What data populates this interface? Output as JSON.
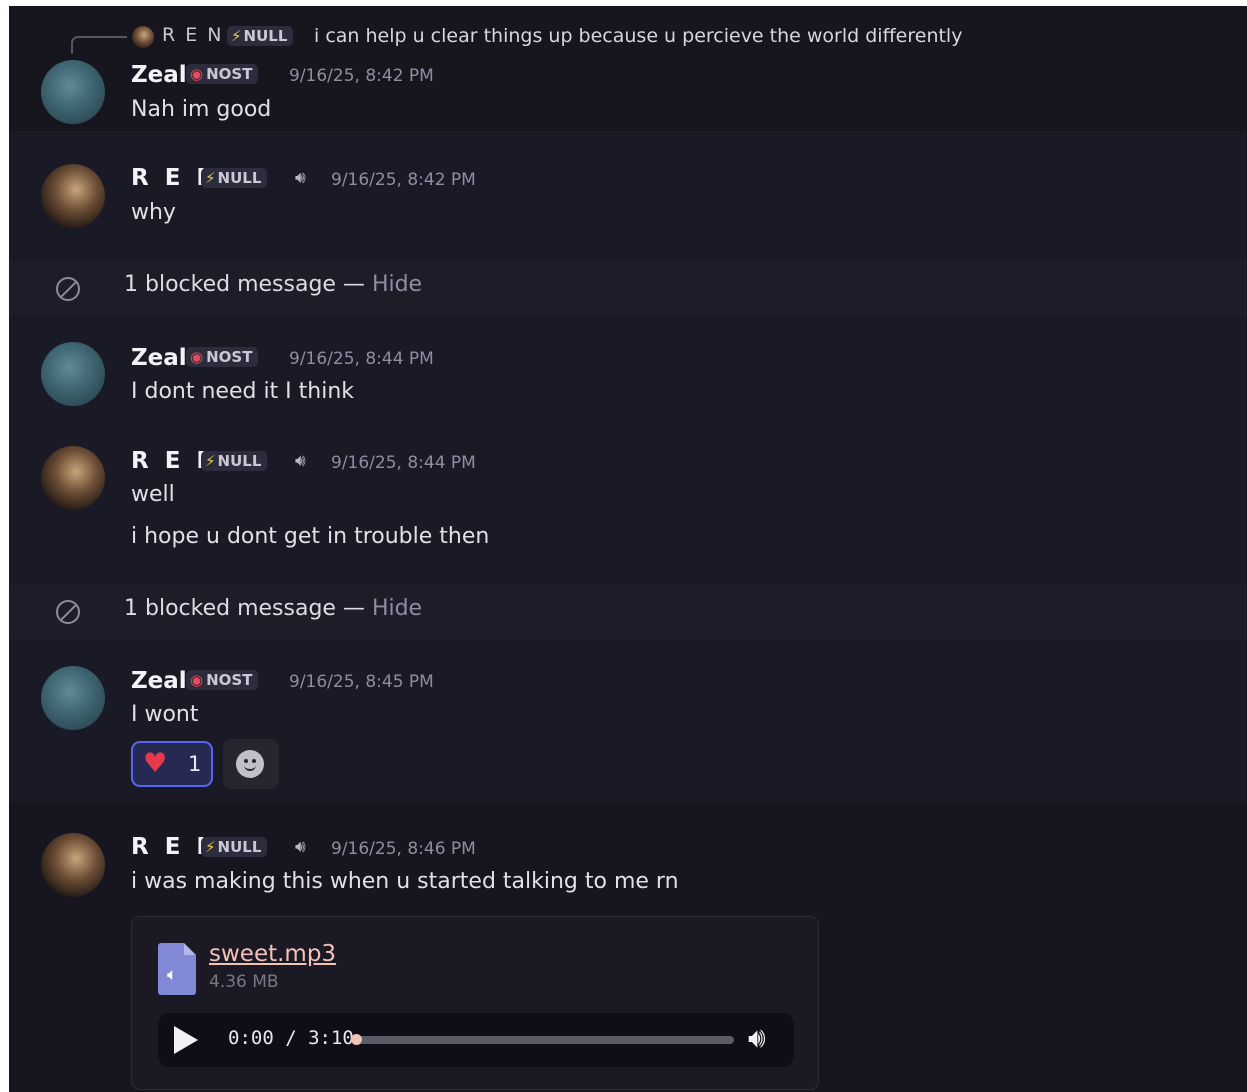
{
  "reply": {
    "author": "R E N",
    "tag": "NULL",
    "text": "i can help u clear things up because u percieve the world differently"
  },
  "messages": [
    {
      "author": "Zeal",
      "tag": "NOST",
      "timestamp": "9/16/25, 8:42 PM",
      "lines": [
        "Nah im good"
      ]
    },
    {
      "author": "R E N",
      "tag": "NULL",
      "timestamp": "9/16/25, 8:42 PM",
      "lines": [
        "why"
      ]
    },
    {
      "author": "Zeal",
      "tag": "NOST",
      "timestamp": "9/16/25, 8:44 PM",
      "lines": [
        "I dont need it I think"
      ]
    },
    {
      "author": "R E N",
      "tag": "NULL",
      "timestamp": "9/16/25, 8:44 PM",
      "lines": [
        "well",
        "i hope u dont get in trouble then"
      ]
    },
    {
      "author": "Zeal",
      "tag": "NOST",
      "timestamp": "9/16/25, 8:45 PM",
      "lines": [
        "I wont"
      ],
      "reactions": [
        {
          "emoji": "heart",
          "count": "1"
        }
      ]
    },
    {
      "author": "R E N",
      "tag": "NULL",
      "timestamp": "9/16/25, 8:46 PM",
      "lines": [
        "i was making this when u started talking to me rn"
      ],
      "attachment": {
        "file_name": "sweet.mp3",
        "file_size": "4.36 MB",
        "player_time": "0:00 / 3:10",
        "progress": 0
      }
    }
  ],
  "blocked": [
    {
      "text": "1 blocked message — ",
      "action": "Hide"
    },
    {
      "text": "1 blocked message — ",
      "action": "Hide"
    }
  ],
  "icons": {
    "tag_null": "lightning-icon",
    "tag_nost": "red-emblem-icon",
    "speaker": "speaker-icon",
    "blocked": "blocked-icon",
    "reaction": "heart-icon",
    "add_reaction": "smile-icon",
    "file": "audio-file-icon",
    "play": "play-icon",
    "volume": "volume-icon"
  },
  "colors": {
    "background": "#15141f",
    "accent": "#5865f2",
    "link": "#f2c1b8",
    "tag_bg": "#2d2c3d"
  }
}
